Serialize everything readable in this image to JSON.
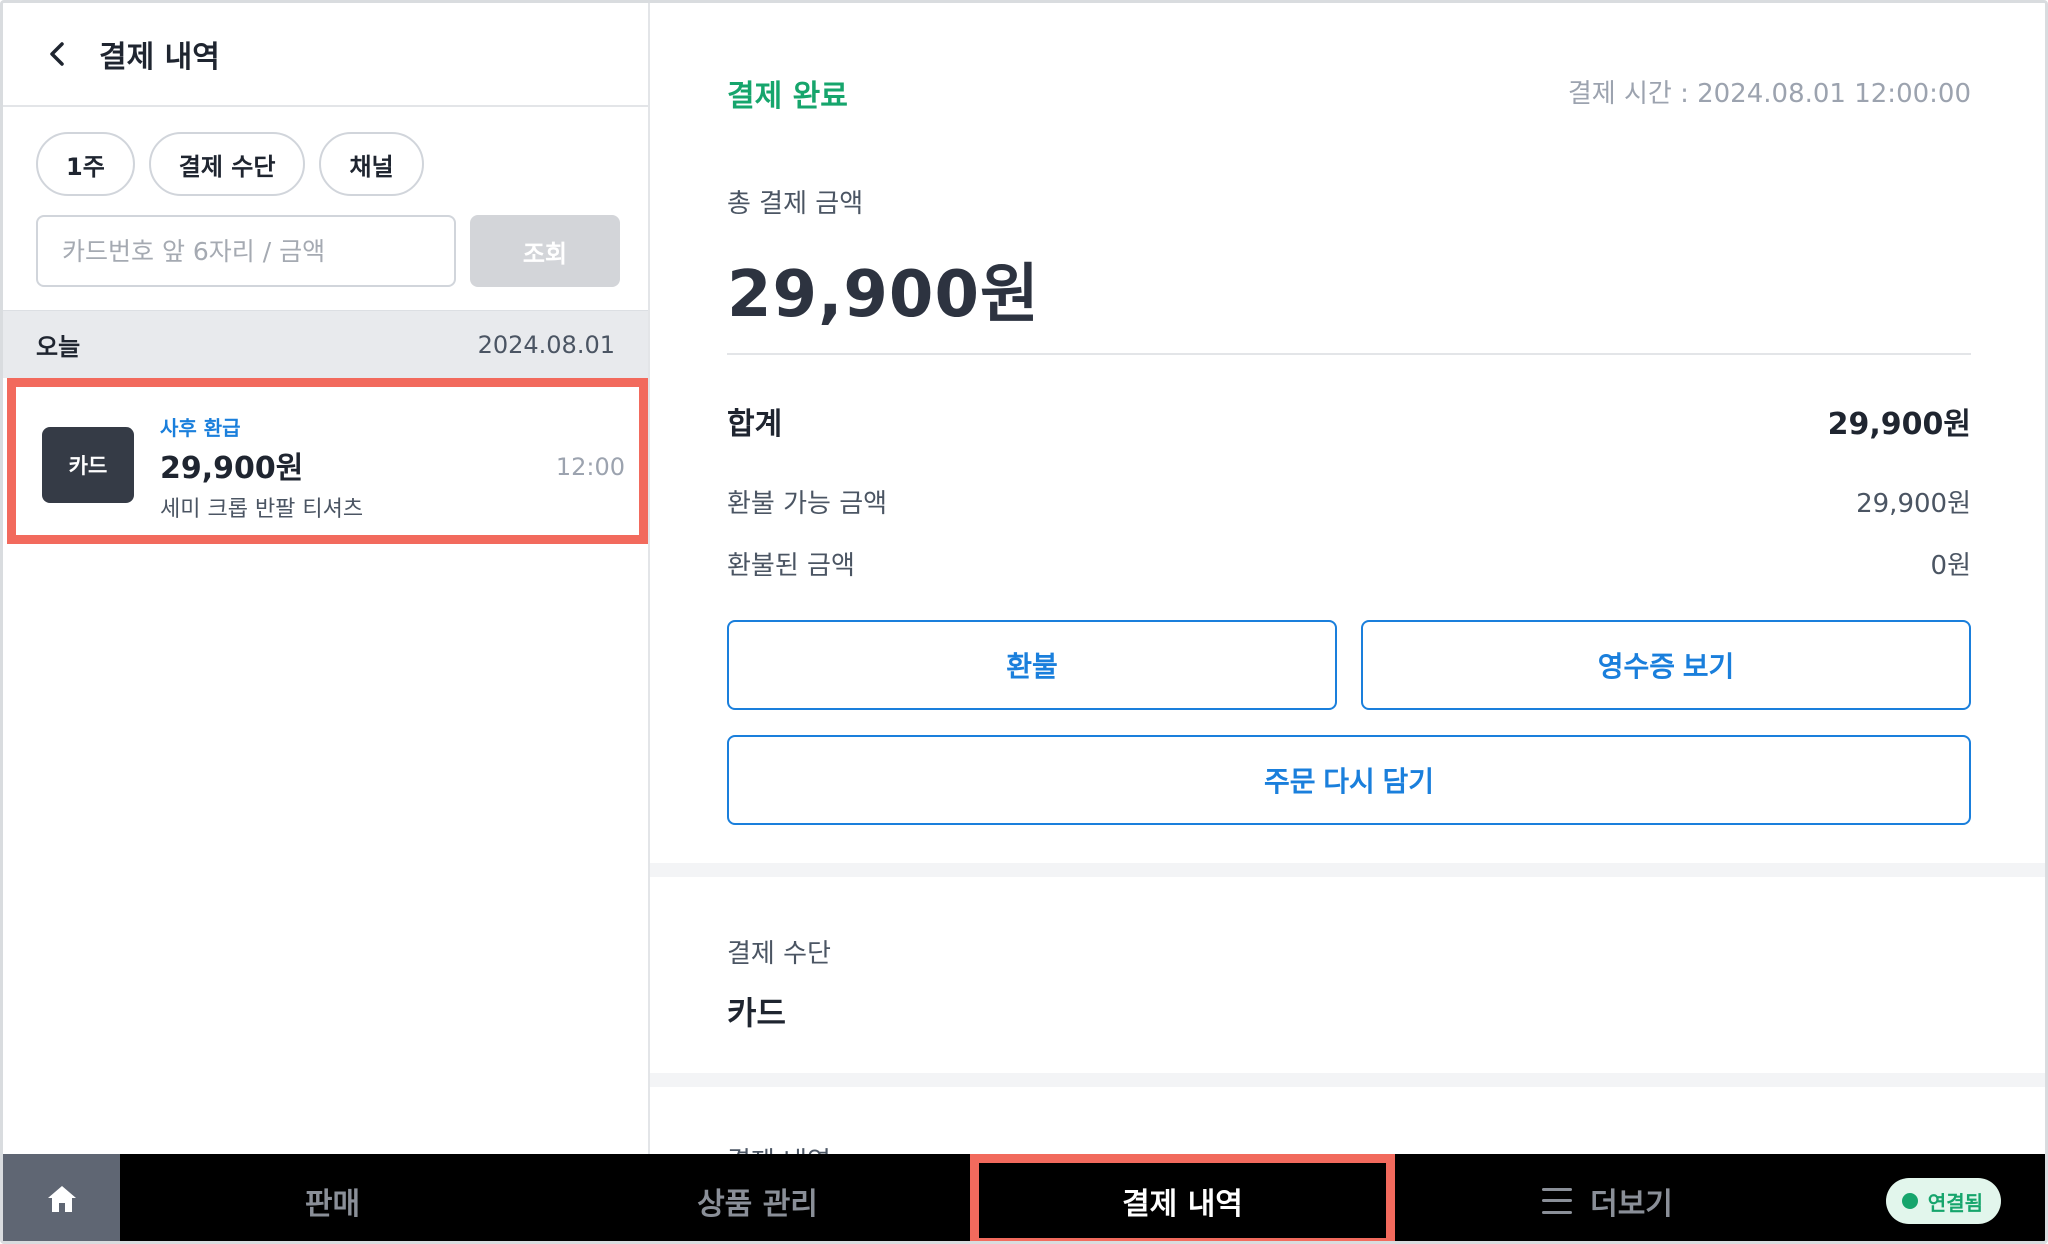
{
  "left": {
    "title": "결제 내역",
    "filters": [
      "1주",
      "결제 수단",
      "채널"
    ],
    "search": {
      "placeholder": "카드번호 앞 6자리 / 금액",
      "button": "조회"
    },
    "group": {
      "day": "오늘",
      "date": "2024.08.01"
    },
    "transaction": {
      "badge": "카드",
      "tag": "사후 환급",
      "amount": "29,900원",
      "description": "세미 크롭 반팔 티셔츠",
      "time": "12:00"
    }
  },
  "detail": {
    "status": "결제 완료",
    "payment_time": "결제 시간 : 2024.08.01 12:00:00",
    "total_label": "총 결제 금액",
    "total_amount": "29,900원",
    "sum_label": "합계",
    "sum_value": "29,900원",
    "refundable_label": "환불 가능 금액",
    "refundable_value": "29,900원",
    "refunded_label": "환불된 금액",
    "refunded_value": "0원",
    "buttons": {
      "refund": "환불",
      "receipt": "영수증 보기",
      "reorder": "주문 다시 담기"
    },
    "method_label": "결제 수단",
    "method_value": "카드",
    "history_label": "결제 내역"
  },
  "nav": {
    "items": [
      "판매",
      "상품 관리",
      "결제 내역",
      "더보기"
    ],
    "connection": "연결됨"
  },
  "colors": {
    "accent_blue": "#1a7fdc",
    "success_green": "#16a56c",
    "highlight_red": "#f26a5d",
    "dark_badge": "#353b46"
  }
}
